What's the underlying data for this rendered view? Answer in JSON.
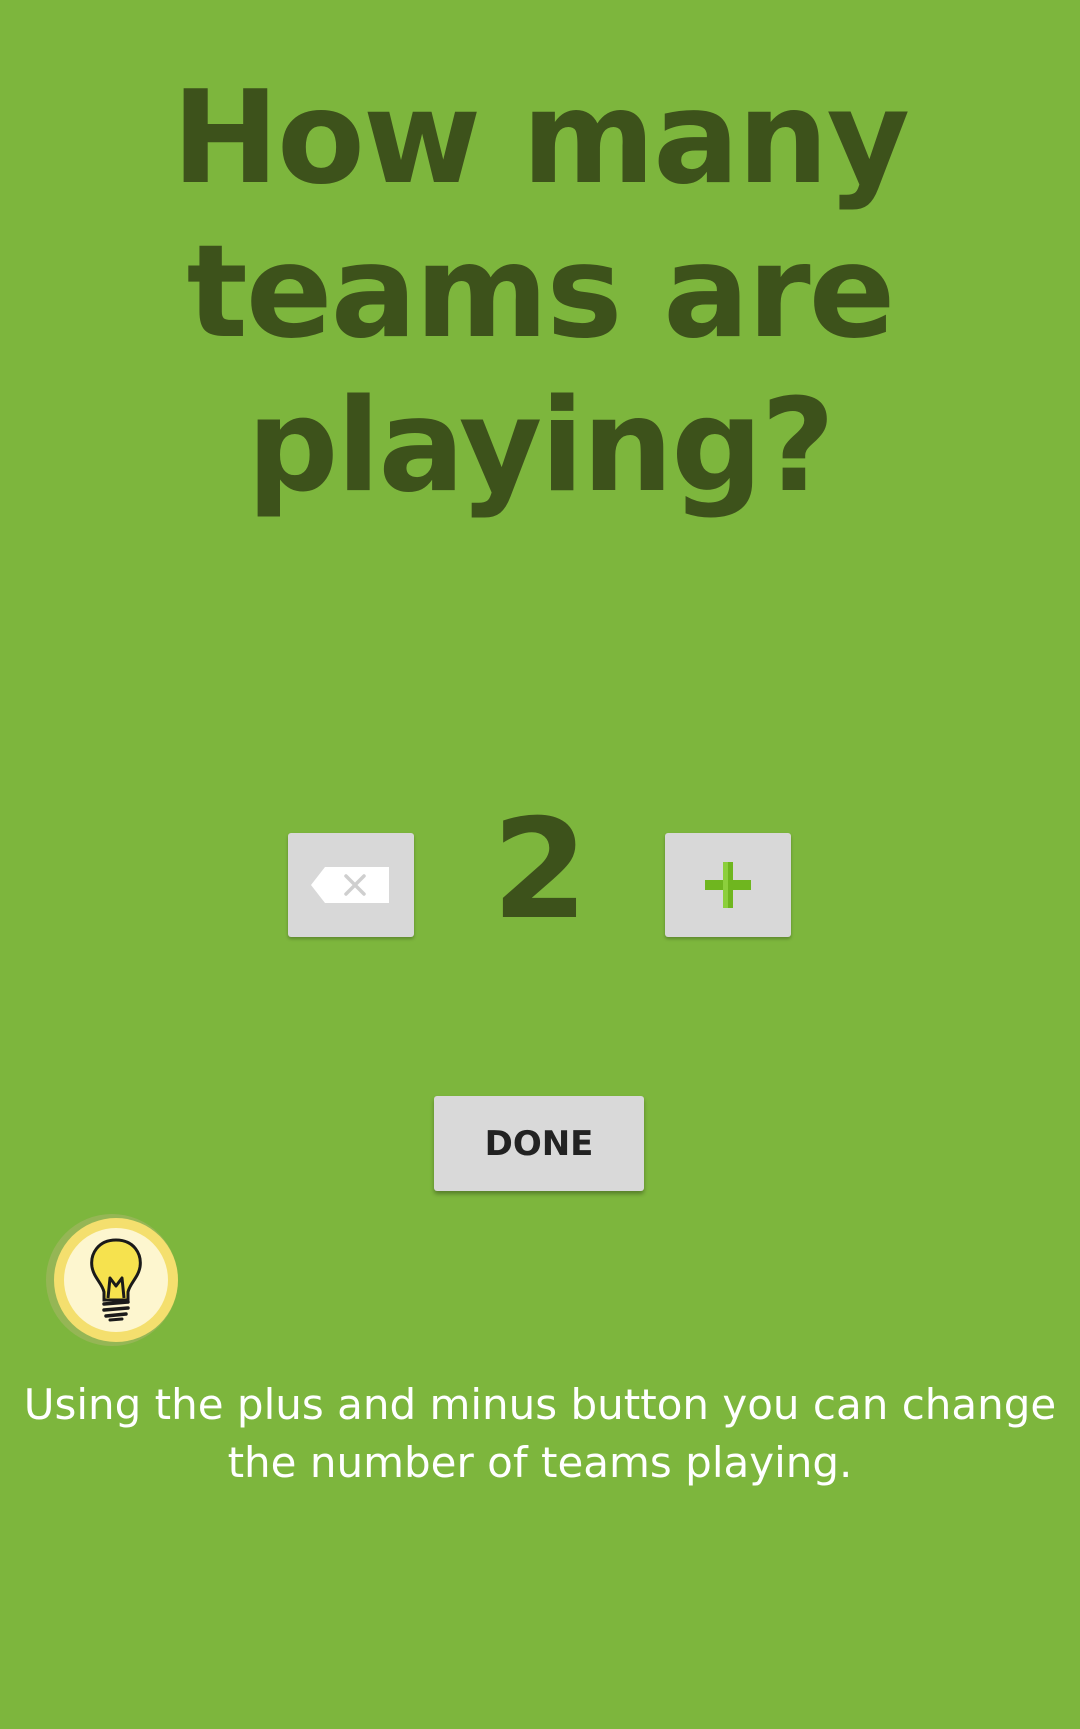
{
  "question": {
    "line1": "How many",
    "line2": "teams are",
    "line3": "playing?"
  },
  "stepper": {
    "value": "2",
    "minus_icon": "backspace-icon",
    "plus_icon": "plus-icon"
  },
  "done_label": "DONE",
  "hint": {
    "icon": "lightbulb-icon",
    "text": "Using the plus and minus button you can change the number of teams playing."
  },
  "colors": {
    "background": "#7db63d",
    "title": "#3d521b",
    "button": "#d8d8d8",
    "plus": "#6fb61f",
    "bulb": "#f5e26a"
  }
}
